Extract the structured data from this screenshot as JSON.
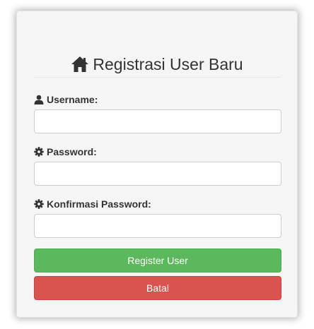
{
  "header": {
    "title": "Registrasi User Baru",
    "icon": "home-icon"
  },
  "form": {
    "username": {
      "label": "Username:",
      "icon": "user-icon",
      "value": "",
      "placeholder": ""
    },
    "password": {
      "label": "Password:",
      "icon": "gear-icon",
      "value": "",
      "placeholder": ""
    },
    "confirm_password": {
      "label": "Konfirmasi Password:",
      "icon": "gear-icon",
      "value": "",
      "placeholder": ""
    }
  },
  "buttons": {
    "register_label": "Register User",
    "cancel_label": "Batal"
  },
  "colors": {
    "register": "#5cb85c",
    "cancel": "#d9534f",
    "panel": "#f5f5f5"
  }
}
